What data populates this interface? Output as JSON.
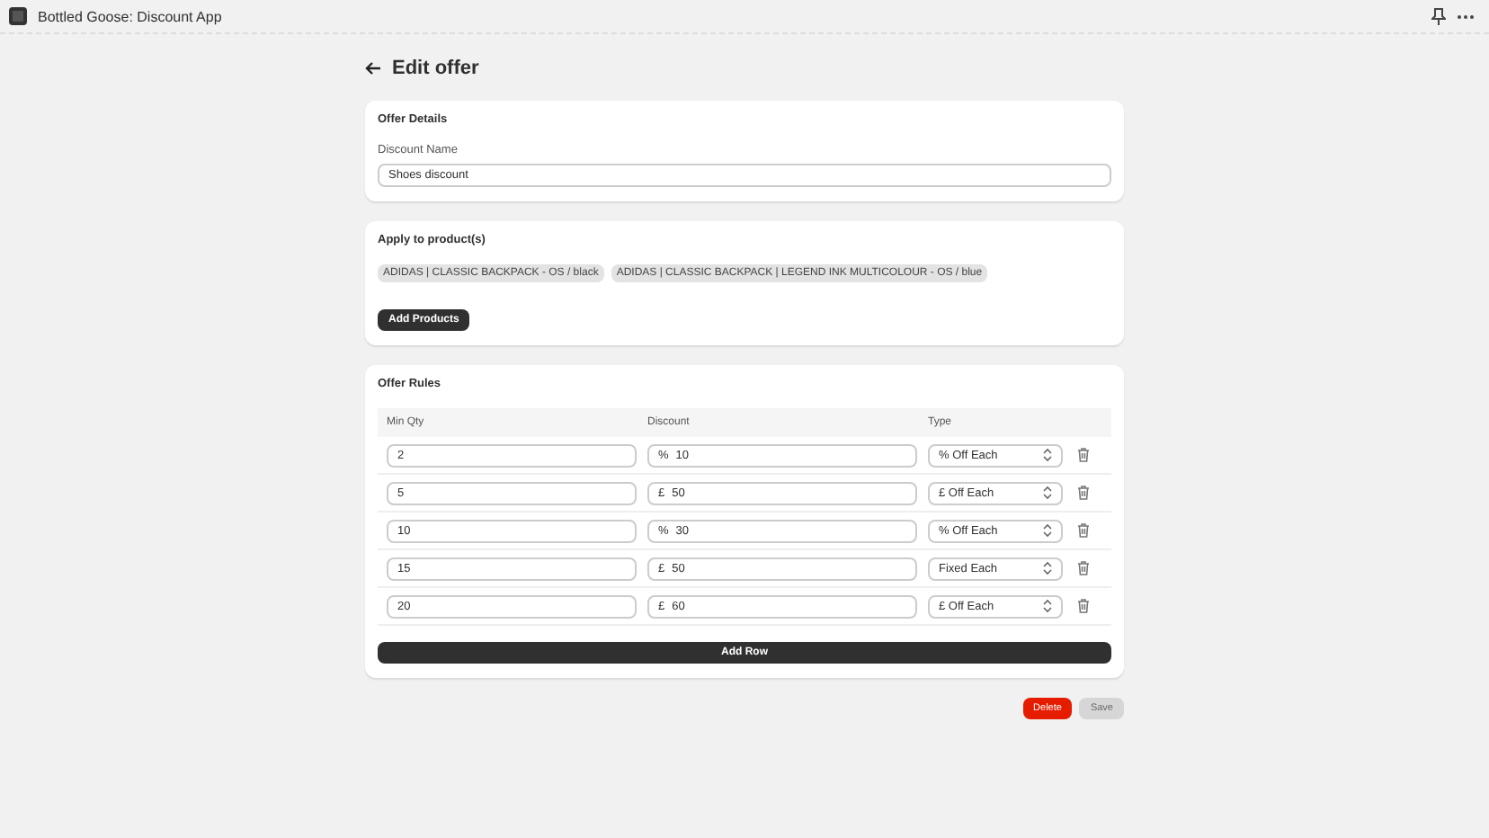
{
  "app_bar": {
    "title": "Bottled Goose: Discount App"
  },
  "page": {
    "title": "Edit offer"
  },
  "offer_details": {
    "heading": "Offer Details",
    "field_label": "Discount Name",
    "value": "Shoes discount"
  },
  "products": {
    "heading": "Apply to product(s)",
    "tags": [
      "ADIDAS | CLASSIC BACKPACK - OS / black",
      "ADIDAS | CLASSIC BACKPACK | LEGEND INK MULTICOLOUR - OS / blue"
    ],
    "add_button": "Add Products"
  },
  "rules": {
    "heading": "Offer Rules",
    "columns": [
      "Min Qty",
      "Discount",
      "Type"
    ],
    "rows": [
      {
        "min_qty": "2",
        "prefix": "%",
        "discount": "10",
        "type": "% Off Each"
      },
      {
        "min_qty": "5",
        "prefix": "£",
        "discount": "50",
        "type": "£ Off Each"
      },
      {
        "min_qty": "10",
        "prefix": "%",
        "discount": "30",
        "type": "% Off Each"
      },
      {
        "min_qty": "15",
        "prefix": "£",
        "discount": "50",
        "type": "Fixed Each"
      },
      {
        "min_qty": "20",
        "prefix": "£",
        "discount": "60",
        "type": "£ Off Each"
      }
    ],
    "add_button": "Add Row"
  },
  "actions": [
    {
      "label": "Delete",
      "kind": "danger",
      "disabled": false
    },
    {
      "label": "Save",
      "kind": "primary",
      "disabled": true
    }
  ]
}
